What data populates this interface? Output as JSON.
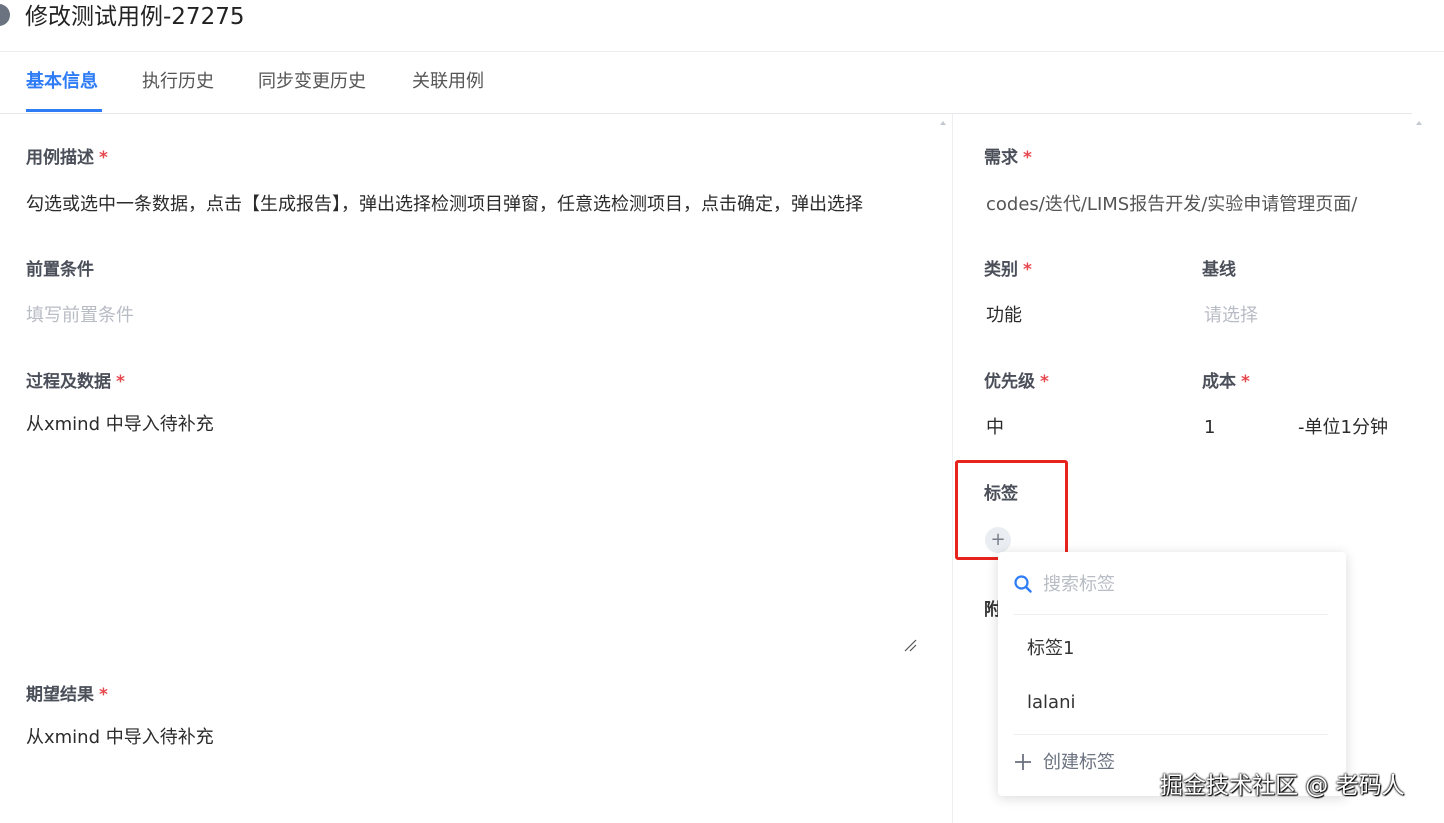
{
  "header": {
    "title": "修改测试用例-27275"
  },
  "tabs": [
    {
      "label": "基本信息"
    },
    {
      "label": "执行历史"
    },
    {
      "label": "同步变更历史"
    },
    {
      "label": "关联用例"
    }
  ],
  "left": {
    "description": {
      "label": "用例描述",
      "required": "*",
      "value": "勾选或选中一条数据，点击【生成报告】，弹出选择检测项目弹窗，任意选检测项目，点击确定，弹出选择"
    },
    "precondition": {
      "label": "前置条件",
      "placeholder": "填写前置条件"
    },
    "steps": {
      "label": "过程及数据",
      "required": "*",
      "value": "从xmind 中导入待补充"
    },
    "expected": {
      "label": "期望结果",
      "required": "*",
      "value": "从xmind 中导入待补充"
    }
  },
  "right": {
    "requirement": {
      "label": "需求",
      "required": "*",
      "value": "codes/迭代/LIMS报告开发/实验申请管理页面/"
    },
    "category": {
      "label": "类别",
      "required": "*",
      "value": "功能"
    },
    "baseline": {
      "label": "基线",
      "placeholder": "请选择"
    },
    "priority": {
      "label": "优先级",
      "required": "*",
      "value": "中"
    },
    "cost": {
      "label": "成本",
      "required": "*",
      "value": "1",
      "unit": "-单位1分钟"
    },
    "tags": {
      "label": "标签",
      "add_symbol": "+"
    },
    "attachment_partial": "附"
  },
  "tag_dropdown": {
    "search_placeholder": "搜索标签",
    "items": [
      "标签1",
      "lalani"
    ],
    "create_label": "创建标签"
  },
  "watermark": "掘金技术社区 @ 老码人",
  "colors": {
    "accent": "#2f7df6",
    "required": "#e5484d",
    "highlight": "#e8231e"
  }
}
